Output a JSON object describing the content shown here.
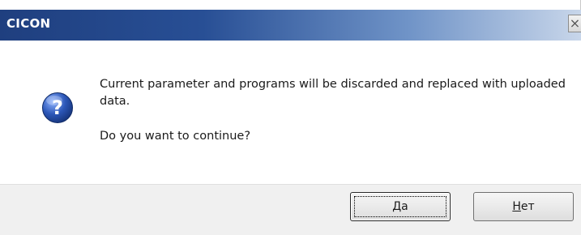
{
  "window": {
    "title": "CICON",
    "close_glyph": "×"
  },
  "message": {
    "line1": "Current parameter and programs will be discarded and replaced with uploaded data.",
    "question": "Do you want to continue?"
  },
  "icon": {
    "name": "question-icon",
    "color": "#2c57b8"
  },
  "buttons": {
    "yes": {
      "accel": "Д",
      "rest": "а"
    },
    "no": {
      "accel": "Н",
      "rest": "ет"
    }
  }
}
